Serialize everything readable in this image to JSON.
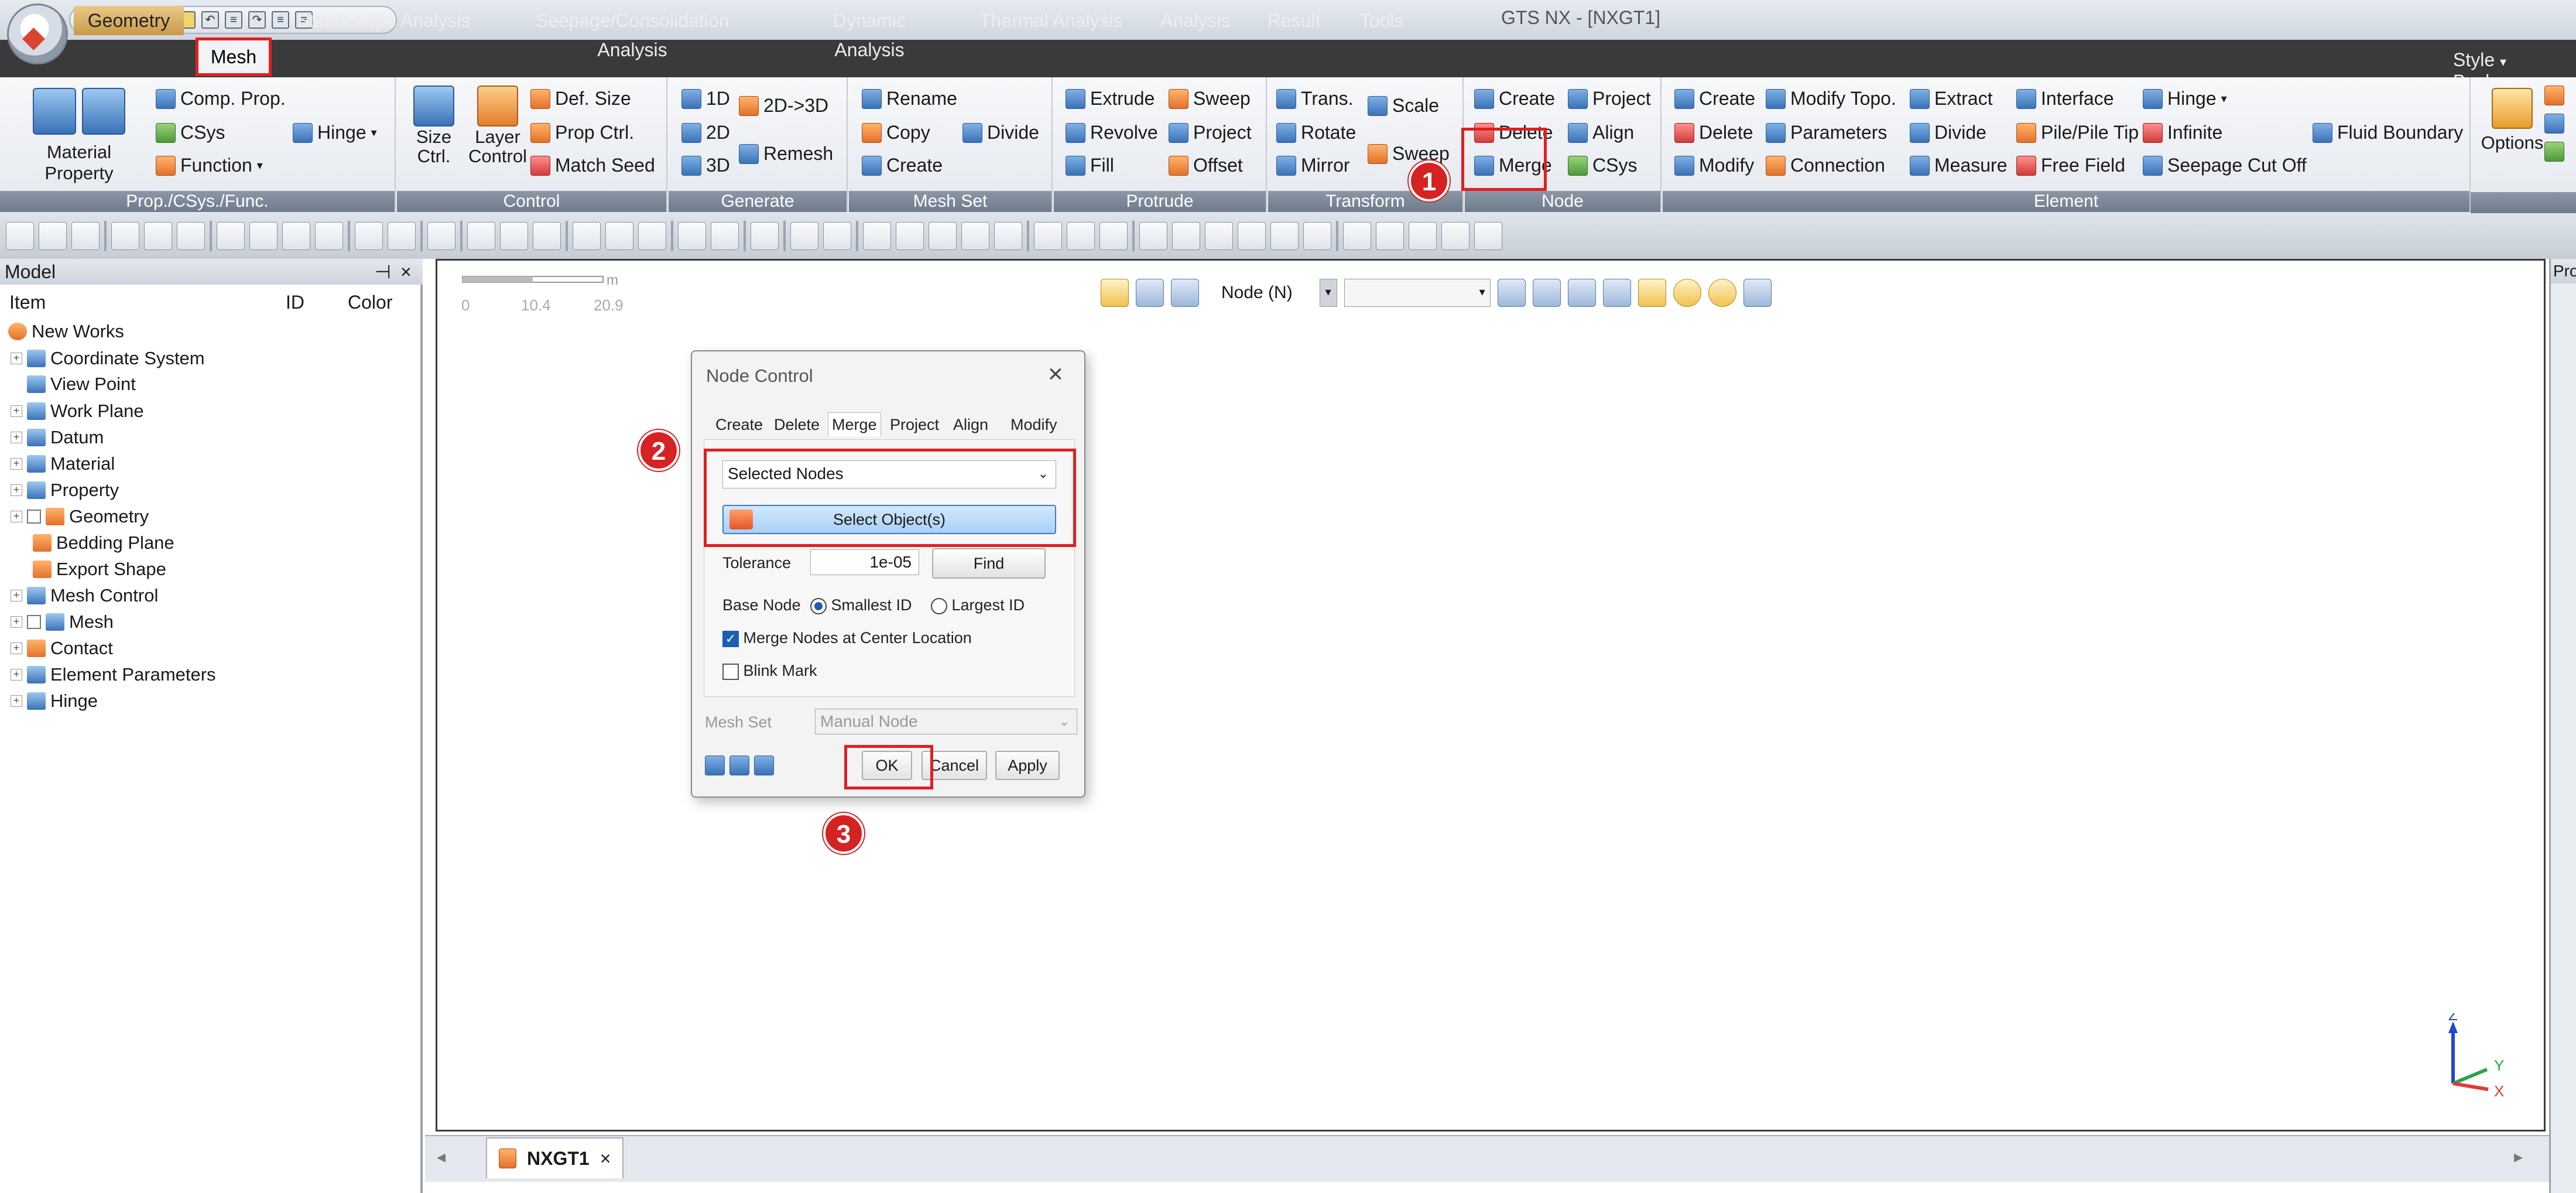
{
  "window": {
    "title": "GTS NX - [NXGT1]"
  },
  "menu": {
    "tabs": [
      "Geometry",
      "Mesh",
      "Static/Slope Analysis",
      "Seepage/Consolidation Analysis",
      "Dynamic Analysis",
      "Thermal Analysis",
      "Analysis",
      "Result",
      "Tools"
    ],
    "style_label": "Style",
    "background_label": "Backgro"
  },
  "ribbon": {
    "prop_group": {
      "caption": "Prop./CSys./Func.",
      "material_property": "Material Property",
      "comp_prop": "Comp. Prop.",
      "csys": "CSys",
      "function": "Function",
      "hinge": "Hinge"
    },
    "control_group": {
      "caption": "Control",
      "size_ctrl_1": "Size",
      "size_ctrl_2": "Ctrl.",
      "layer_control_1": "Layer",
      "layer_control_2": "Control",
      "def_size": "Def. Size",
      "prop_ctrl": "Prop Ctrl.",
      "match_seed": "Match Seed"
    },
    "generate_group": {
      "caption": "Generate",
      "gen_1d": "1D",
      "gen_2d": "2D",
      "gen_3d": "3D",
      "gen_2d_3d": "2D->3D",
      "remesh": "Remesh"
    },
    "meshset_group": {
      "caption": "Mesh Set",
      "rename": "Rename",
      "copy": "Copy",
      "divide": "Divide",
      "create": "Create"
    },
    "protrude_group": {
      "caption": "Protrude",
      "extrude": "Extrude",
      "sweep": "Sweep",
      "revolve": "Revolve",
      "project": "Project",
      "fill": "Fill",
      "offset": "Offset"
    },
    "transform_group": {
      "caption": "Transform",
      "trans": "Trans.",
      "scale": "Scale",
      "rotate": "Rotate",
      "mirror": "Mirror",
      "sweep": "Sweep"
    },
    "node_group": {
      "caption": "Node",
      "create": "Create",
      "project": "Project",
      "delete": "Delete",
      "align": "Align",
      "merge": "Merge",
      "csys": "CSys"
    },
    "element_group": {
      "caption": "Element",
      "create": "Create",
      "modify_topo": "Modify Topo.",
      "extract": "Extract",
      "interface": "Interface",
      "hinge": "Hinge",
      "delete": "Delete",
      "parameters": "Parameters",
      "divide": "Divide",
      "pile": "Pile/Pile Tip",
      "infinite": "Infinite",
      "fluid_boundary": "Fluid Boundary",
      "modify": "Modify",
      "connection": "Connection",
      "measure": "Measure",
      "free_field": "Free Field",
      "seepage_cut_off": "Seepage Cut Off"
    },
    "options": "Options"
  },
  "model_panel": {
    "title": "Model",
    "pin": "⊣",
    "close": "×",
    "columns": {
      "item": "Item",
      "id": "ID",
      "color": "Color"
    },
    "root": "New Works",
    "items": [
      "Coordinate System",
      "View Point",
      "Work Plane",
      "Datum",
      "Material",
      "Property",
      "Geometry",
      "Bedding Plane",
      "Export Shape",
      "Mesh Control",
      "Mesh",
      "Contact",
      "Element Parameters",
      "Hinge"
    ]
  },
  "right_strip": {
    "label": "Pro"
  },
  "viewport": {
    "scale": {
      "unit": "m",
      "ticks": [
        "0",
        "10.4",
        "20.9"
      ]
    },
    "filter_label": "Node (N)",
    "tab_label": "NXGT1",
    "tab_close": "×",
    "axis": {
      "z": "Z",
      "y": "Y",
      "x": "X"
    }
  },
  "dialog": {
    "title": "Node Control",
    "close": "×",
    "tabs": [
      "Create",
      "Delete",
      "Merge",
      "Project",
      "Align",
      "Modify"
    ],
    "active_tab": "Merge",
    "target_select": "Selected Nodes",
    "select_objects": "Select Object(s)",
    "tolerance_label": "Tolerance",
    "tolerance_value": "1e-05",
    "find": "Find",
    "base_node_label": "Base Node",
    "smallest_id": "Smallest ID",
    "largest_id": "Largest ID",
    "merge_center": "Merge Nodes at Center Location",
    "blink_mark": "Blink Mark",
    "mesh_set_label": "Mesh Set",
    "mesh_set_value": "Manual Node",
    "ok": "OK",
    "cancel": "Cancel",
    "apply": "Apply"
  },
  "annotations": {
    "step1": "1",
    "step2": "2",
    "step3": "3"
  },
  "colors": {
    "highlight": "#e02020",
    "badge": "#d62222",
    "menubar": "#3a3a3a",
    "active_tab": "#c99a46",
    "select_button": "#a9d0f5"
  }
}
